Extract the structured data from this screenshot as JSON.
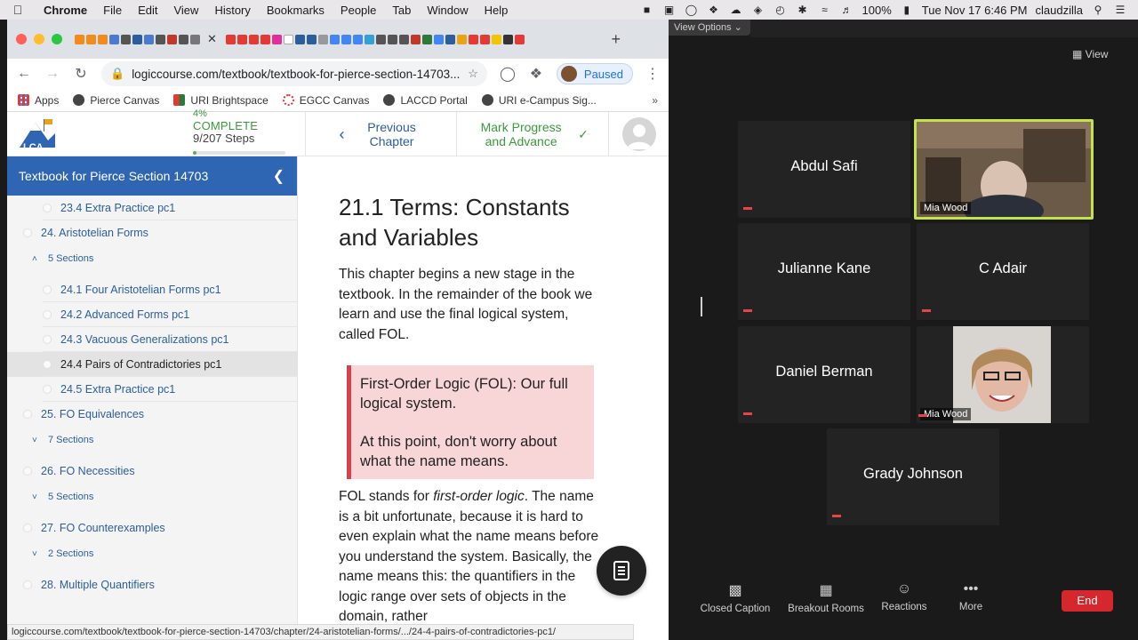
{
  "menubar": {
    "app": "Chrome",
    "items": [
      "File",
      "Edit",
      "View",
      "History",
      "Bookmarks",
      "People",
      "Tab",
      "Window",
      "Help"
    ],
    "battery": "100%",
    "datetime": "Tue Nov 17  6:46 PM",
    "user": "claudzilla"
  },
  "chrome": {
    "url": "logiccourse.com/textbook/textbook-for-pierce-section-14703...",
    "profile_label": "Paused",
    "bookmarks": [
      "Apps",
      "Pierce Canvas",
      "URI Brightspace",
      "EGCC Canvas",
      "LACCD Portal",
      "URI e-Campus Sig..."
    ],
    "status_url": "logiccourse.com/textbook/textbook-for-pierce-section-14703/chapter/24-aristotelian-forms/.../24-4-pairs-of-contradictories-pc1/"
  },
  "course": {
    "logo_text": "LCA",
    "progress_pct": "4%",
    "progress_title": "COMPLETE",
    "progress_steps": "9/207 Steps",
    "progress_fraction": 0.04,
    "prev_chapter": "Previous Chapter",
    "mark_progress": "Mark Progress and Advance"
  },
  "sidebar": {
    "title": "Textbook for Pierce Section 14703",
    "rows": [
      {
        "kind": "topic",
        "label": "23.4 Extra Practice pc1"
      },
      {
        "kind": "lesson",
        "label": "24. Aristotelian Forms"
      },
      {
        "kind": "sections",
        "label": "5 Sections",
        "expanded": true
      },
      {
        "kind": "topic",
        "label": "24.1 Four Aristotelian Forms pc1"
      },
      {
        "kind": "topic",
        "label": "24.2 Advanced Forms pc1"
      },
      {
        "kind": "topic",
        "label": "24.3 Vacuous Generalizations pc1"
      },
      {
        "kind": "topic",
        "label": "24.4 Pairs of Contradictories pc1",
        "highlight": true
      },
      {
        "kind": "topic",
        "label": "24.5 Extra Practice pc1"
      },
      {
        "kind": "lesson",
        "label": "25. FO Equivalences"
      },
      {
        "kind": "sections",
        "label": "7 Sections",
        "expanded": false
      },
      {
        "kind": "lesson",
        "label": "26. FO Necessities"
      },
      {
        "kind": "sections",
        "label": "5 Sections",
        "expanded": false
      },
      {
        "kind": "lesson",
        "label": "27. FO Counterexamples"
      },
      {
        "kind": "sections",
        "label": "2 Sections",
        "expanded": false
      },
      {
        "kind": "lesson",
        "label": "28. Multiple Quantifiers"
      }
    ]
  },
  "content": {
    "title": "21.1 Terms: Constants and Variables",
    "intro": "This chapter begins a new stage in the textbook. In the remainder of the book we learn and use the final logical system, called FOL.",
    "callout_1": "First-Order Logic (FOL): Our full logical system.",
    "callout_2": "At this point, don't worry about what the name means.",
    "body_prefix": "FOL stands for ",
    "body_em": "first-order logic",
    "body_rest": ". The name is a bit unfortunate, because it is hard to even explain what the name means before you understand the system. Basically, the name means this: the quantifiers in the logic range over sets of objects in the domain, rather"
  },
  "zoom": {
    "view_options": "View Options",
    "view": "View",
    "participants": [
      {
        "name": "Abdul Safi"
      },
      {
        "name": "Mia Wood",
        "video": true,
        "active": true
      },
      {
        "name": "Julianne Kane"
      },
      {
        "name": "C Adair"
      },
      {
        "name": "Daniel Berman"
      },
      {
        "name": "Mia Wood",
        "video": true
      },
      {
        "name": "Grady Johnson"
      }
    ],
    "toolbar": [
      "Closed Caption",
      "Breakout Rooms",
      "Reactions",
      "More"
    ],
    "end": "End"
  },
  "colors": {
    "sidebar_header": "#2f66b3",
    "link": "#2b5e9b",
    "progress_green": "#3b9a3b",
    "callout_bg": "#f8d5d7",
    "callout_border": "#d8404a",
    "zoom_active": "#c4e34a",
    "end_red": "#d6272e"
  }
}
